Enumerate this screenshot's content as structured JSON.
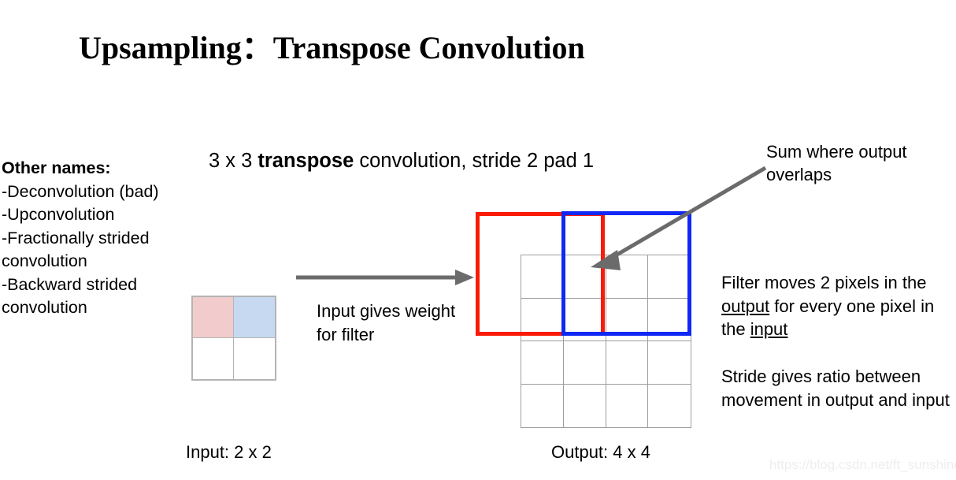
{
  "title": "Upsampling：Transpose Convolution",
  "other_names": {
    "heading": "Other names:",
    "items": [
      "-Deconvolution (bad)",
      "-Upconvolution",
      "-Fractionally strided convolution",
      "-Backward strided convolution"
    ]
  },
  "diagram": {
    "heading_pre": "3 x 3 ",
    "heading_bold": "transpose",
    "heading_post": " convolution, stride 2 pad 1",
    "input_caption": "Input: 2 x 2",
    "output_caption": "Output: 4 x 4",
    "arrow_caption": "Input gives weight for filter",
    "input_grid": {
      "rows": 2,
      "cols": 2,
      "cell_colors": [
        "#f2cccc",
        "#c6d9f1",
        "#ffffff",
        "#ffffff"
      ],
      "border_color": "#b4b4b4"
    },
    "output_grid": {
      "rows": 4,
      "cols": 4,
      "border_color": "#9e9e9e"
    },
    "filter_boxes": [
      {
        "name": "red-filter-window",
        "color": "#f91b05"
      },
      {
        "name": "blue-filter-window",
        "color": "#1028f4"
      }
    ]
  },
  "annotations": {
    "sum_note": "Sum where output overlaps",
    "filter_note": {
      "part1": "Filter moves 2 pixels in the ",
      "underline1": "output",
      "part2": " for every one pixel in the ",
      "underline2": "input"
    },
    "stride_note": "Stride gives ratio between movement in output and input"
  },
  "watermark": "https://blog.csdn.net/ft_sunshine"
}
